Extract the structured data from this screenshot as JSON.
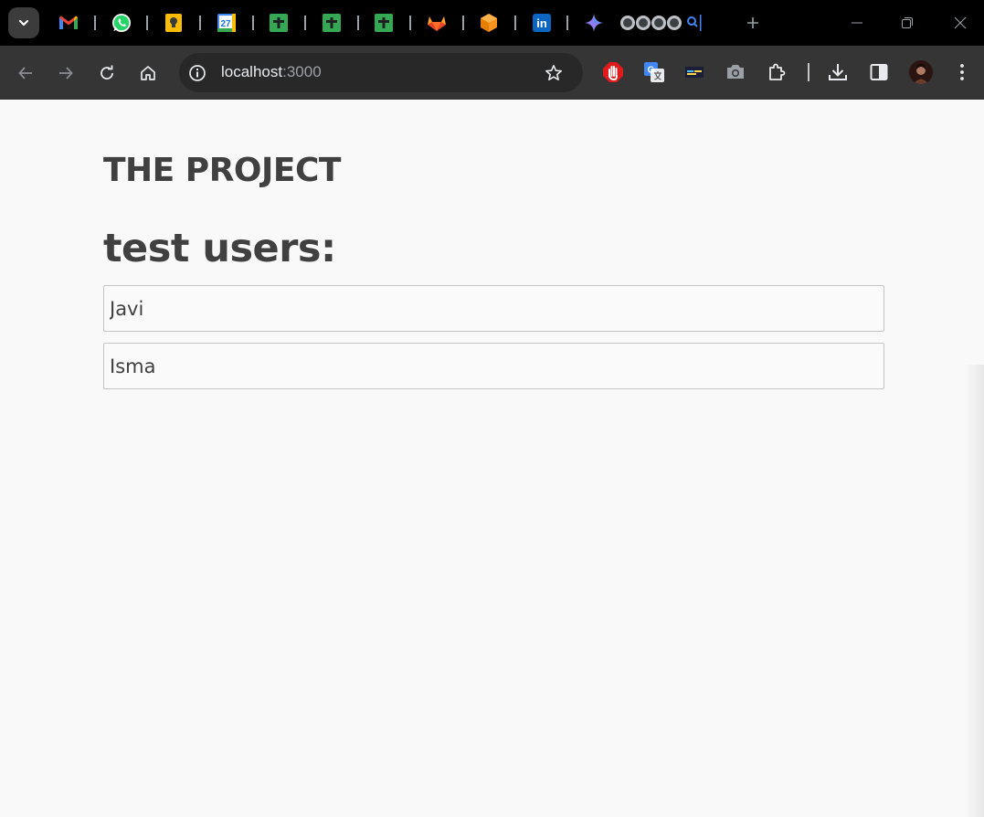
{
  "browser": {
    "url_host": "localhost",
    "url_port": ":3000",
    "pinned_tabs": [
      {
        "name": "gmail",
        "icon": "gmail-icon"
      },
      {
        "name": "whatsapp",
        "icon": "whatsapp-icon"
      },
      {
        "name": "keep",
        "icon": "keep-icon"
      },
      {
        "name": "calendar",
        "icon": "calendar-icon",
        "text": "27"
      },
      {
        "name": "sheets-1",
        "icon": "sheets-icon"
      },
      {
        "name": "sheets-2",
        "icon": "sheets-icon"
      },
      {
        "name": "sheets-3",
        "icon": "sheets-icon"
      },
      {
        "name": "gitlab",
        "icon": "gitlab-icon"
      },
      {
        "name": "box",
        "icon": "box-icon"
      },
      {
        "name": "linkedin",
        "icon": "linkedin-icon",
        "text": "in"
      },
      {
        "name": "gemini",
        "icon": "gemini-icon"
      }
    ]
  },
  "page": {
    "title": "THE PROJECT",
    "users_heading": "test users:",
    "users": [
      "Javi",
      "Isma"
    ]
  },
  "colors": {
    "text": "#404040",
    "page_background": "#f9f9f9",
    "toolbar": "#353535",
    "tabstrip": "#000000"
  }
}
